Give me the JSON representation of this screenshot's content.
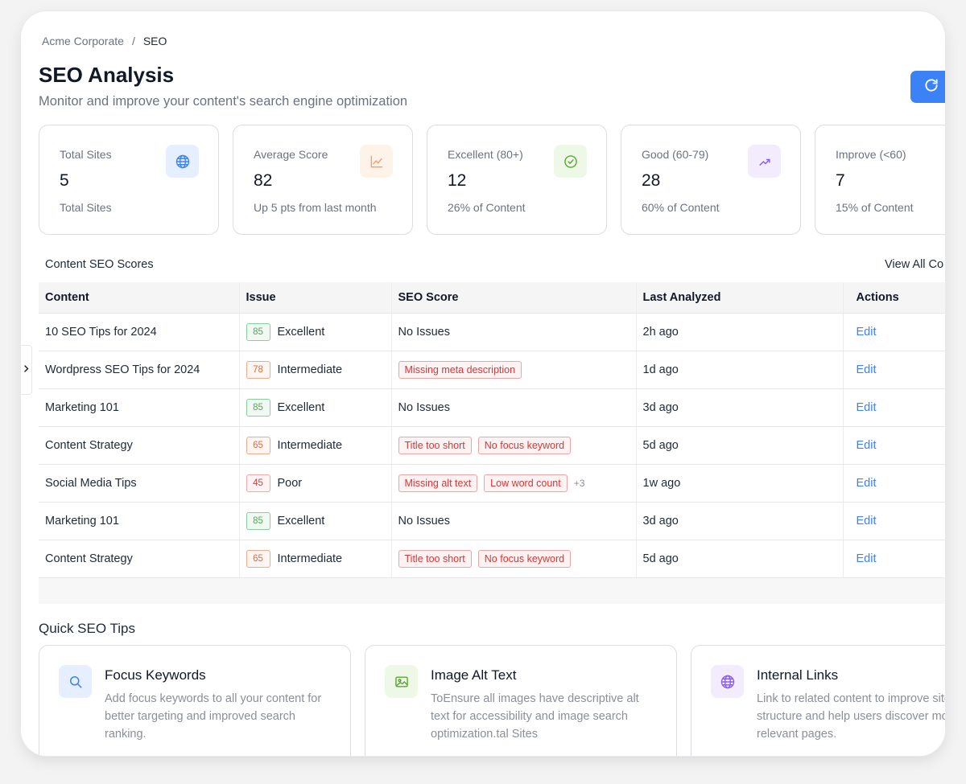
{
  "breadcrumb": {
    "org": "Acme Corporate",
    "sep": "/",
    "current": "SEO"
  },
  "header": {
    "title": "SEO Analysis",
    "subtitle": "Monitor and improve your content's search engine optimization"
  },
  "stats": [
    {
      "label": "Total Sites",
      "value": "5",
      "sub": "Total Sites",
      "icon": "globe-icon",
      "color": "#3b82f6"
    },
    {
      "label": "Average Score",
      "value": "82",
      "sub": "Up 5 pts from last month",
      "icon": "chart-icon",
      "color": "#f59e70"
    },
    {
      "label": "Excellent (80+)",
      "value": "12",
      "sub": "26% of Content",
      "icon": "check-circle-icon",
      "color": "#5aa832"
    },
    {
      "label": "Good (60-79)",
      "value": "28",
      "sub": "60% of Content",
      "icon": "trending-up-icon",
      "color": "#8b5cf6"
    },
    {
      "label": "Improve (<60)",
      "value": "7",
      "sub": "15% of Content"
    }
  ],
  "content": {
    "title": "Content SEO Scores",
    "view_all": "View All Co",
    "columns": [
      "Content",
      "Issue",
      "SEO Score",
      "Last Analyzed",
      "Actions"
    ],
    "rows": [
      {
        "content": "10 SEO Tips for 2024",
        "score": "85",
        "level": "Excellent",
        "issues": [],
        "no_issues": "No Issues",
        "more": "",
        "last": "2h ago",
        "action": "Edit"
      },
      {
        "content": "Wordpress SEO Tips for 2024",
        "score": "78",
        "level": "Intermediate",
        "issues": [
          "Missing meta description"
        ],
        "no_issues": "",
        "more": "",
        "last": "1d ago",
        "action": "Edit"
      },
      {
        "content": "Marketing 101",
        "score": "85",
        "level": "Excellent",
        "issues": [],
        "no_issues": "No Issues",
        "more": "",
        "last": "3d ago",
        "action": "Edit"
      },
      {
        "content": "Content Strategy",
        "score": "65",
        "level": "Intermediate",
        "issues": [
          "Title too short",
          "No focus keyword"
        ],
        "no_issues": "",
        "more": "",
        "last": "5d ago",
        "action": "Edit"
      },
      {
        "content": "Social Media Tips",
        "score": "45",
        "level": "Poor",
        "issues": [
          "Missing alt text",
          "Low word count"
        ],
        "no_issues": "",
        "more": "+3",
        "last": "1w ago",
        "action": "Edit"
      },
      {
        "content": "Marketing 101",
        "score": "85",
        "level": "Excellent",
        "issues": [],
        "no_issues": "No Issues",
        "more": "",
        "last": "3d ago",
        "action": "Edit"
      },
      {
        "content": "Content Strategy",
        "score": "65",
        "level": "Intermediate",
        "issues": [
          "Title too short",
          "No focus keyword"
        ],
        "no_issues": "",
        "more": "",
        "last": "5d ago",
        "action": "Edit"
      }
    ]
  },
  "tips": {
    "title": "Quick SEO Tips",
    "items": [
      {
        "title": "Focus Keywords",
        "desc": "Add focus keywords to all your content for better targeting and improved search ranking.",
        "icon": "search-icon",
        "color": "#3b82f6"
      },
      {
        "title": "Image Alt Text",
        "desc": "ToEnsure all images have descriptive alt text for accessibility and image search optimization.tal Sites",
        "icon": "image-icon",
        "color": "#5aa832"
      },
      {
        "title": "Internal Links",
        "desc": "Link to related content to improve site structure and help users discover more relevant pages.",
        "icon": "globe-icon",
        "color": "#8b5cf6"
      }
    ]
  }
}
